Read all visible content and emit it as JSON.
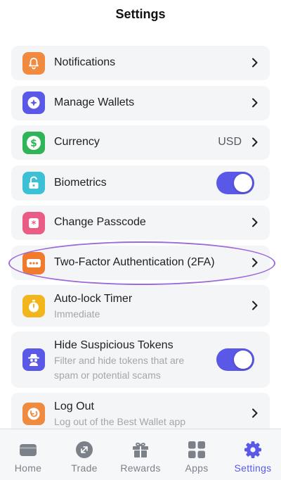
{
  "header": {
    "title": "Settings"
  },
  "rows": [
    {
      "id": "notifications",
      "label": "Notifications",
      "icon": "bell-icon",
      "color": "#f08a3e"
    },
    {
      "id": "manage-wallets",
      "label": "Manage Wallets",
      "icon": "wallet-icon",
      "color": "#5a58e6"
    },
    {
      "id": "currency",
      "label": "Currency",
      "value": "USD",
      "icon": "dollar-icon",
      "color": "#2fb557"
    },
    {
      "id": "biometrics",
      "label": "Biometrics",
      "icon": "unlock-icon",
      "color": "#3cc0d6",
      "toggle": true
    },
    {
      "id": "change-passcode",
      "label": "Change Passcode",
      "icon": "asterisk-icon",
      "color": "#ea5c86"
    },
    {
      "id": "two-factor",
      "label": "Two-Factor Authentication (2FA)",
      "icon": "password-dots-icon",
      "color": "#f07a2e"
    },
    {
      "id": "auto-lock",
      "label": "Auto-lock Timer",
      "sub": "Immediate",
      "icon": "stopwatch-icon",
      "color": "#f2b51c"
    },
    {
      "id": "hide-tokens",
      "label": "Hide Suspicious Tokens",
      "sub": "Filter and hide tokens that are spam or potential scams",
      "icon": "spy-icon",
      "color": "#5a58e6",
      "toggle": true
    },
    {
      "id": "log-out",
      "label": "Log Out",
      "sub": "Log out of the Best Wallet app",
      "icon": "logout-icon",
      "color": "#f08a3e"
    }
  ],
  "tabbar": [
    {
      "label": "Home",
      "icon": "wallet-card-icon"
    },
    {
      "label": "Trade",
      "icon": "swap-icon"
    },
    {
      "label": "Rewards",
      "icon": "gift-icon"
    },
    {
      "label": "Apps",
      "icon": "grid-icon"
    },
    {
      "label": "Settings",
      "icon": "gear-icon",
      "active": true
    }
  ],
  "colors": {
    "accent": "#5a58e6",
    "highlight": "#9c6ad9",
    "card": "#f4f5f7"
  }
}
